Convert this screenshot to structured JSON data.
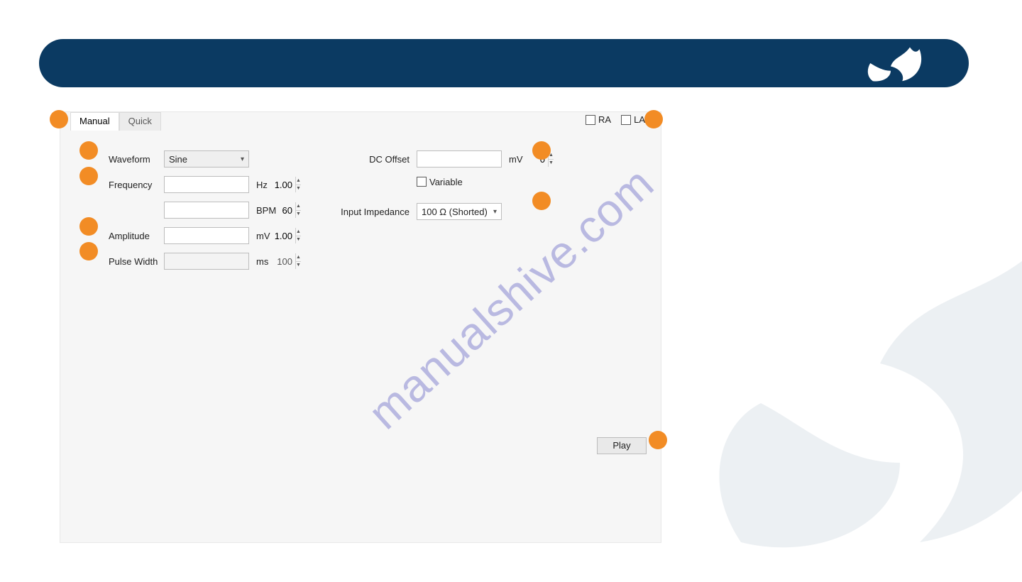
{
  "tabs": {
    "manual": "Manual",
    "quick": "Quick"
  },
  "leads": {
    "ra": "RA",
    "la": "LA"
  },
  "left": {
    "waveform_label": "Waveform",
    "waveform_value": "Sine",
    "frequency_label": "Frequency",
    "frequency_value": "1.00",
    "frequency_unit": "Hz",
    "bpm_value": "60",
    "bpm_unit": "BPM",
    "amplitude_label": "Amplitude",
    "amplitude_value": "1.00",
    "amplitude_unit": "mV",
    "pulsewidth_label": "Pulse Width",
    "pulsewidth_value": "100",
    "pulsewidth_unit": "ms"
  },
  "right": {
    "dcoffset_label": "DC Offset",
    "dcoffset_value": "0",
    "dcoffset_unit": "mV",
    "variable_label": "Variable",
    "impedance_label": "Input Impedance",
    "impedance_value": "100 Ω (Shorted)"
  },
  "play_label": "Play",
  "watermark": "manualshive.com"
}
